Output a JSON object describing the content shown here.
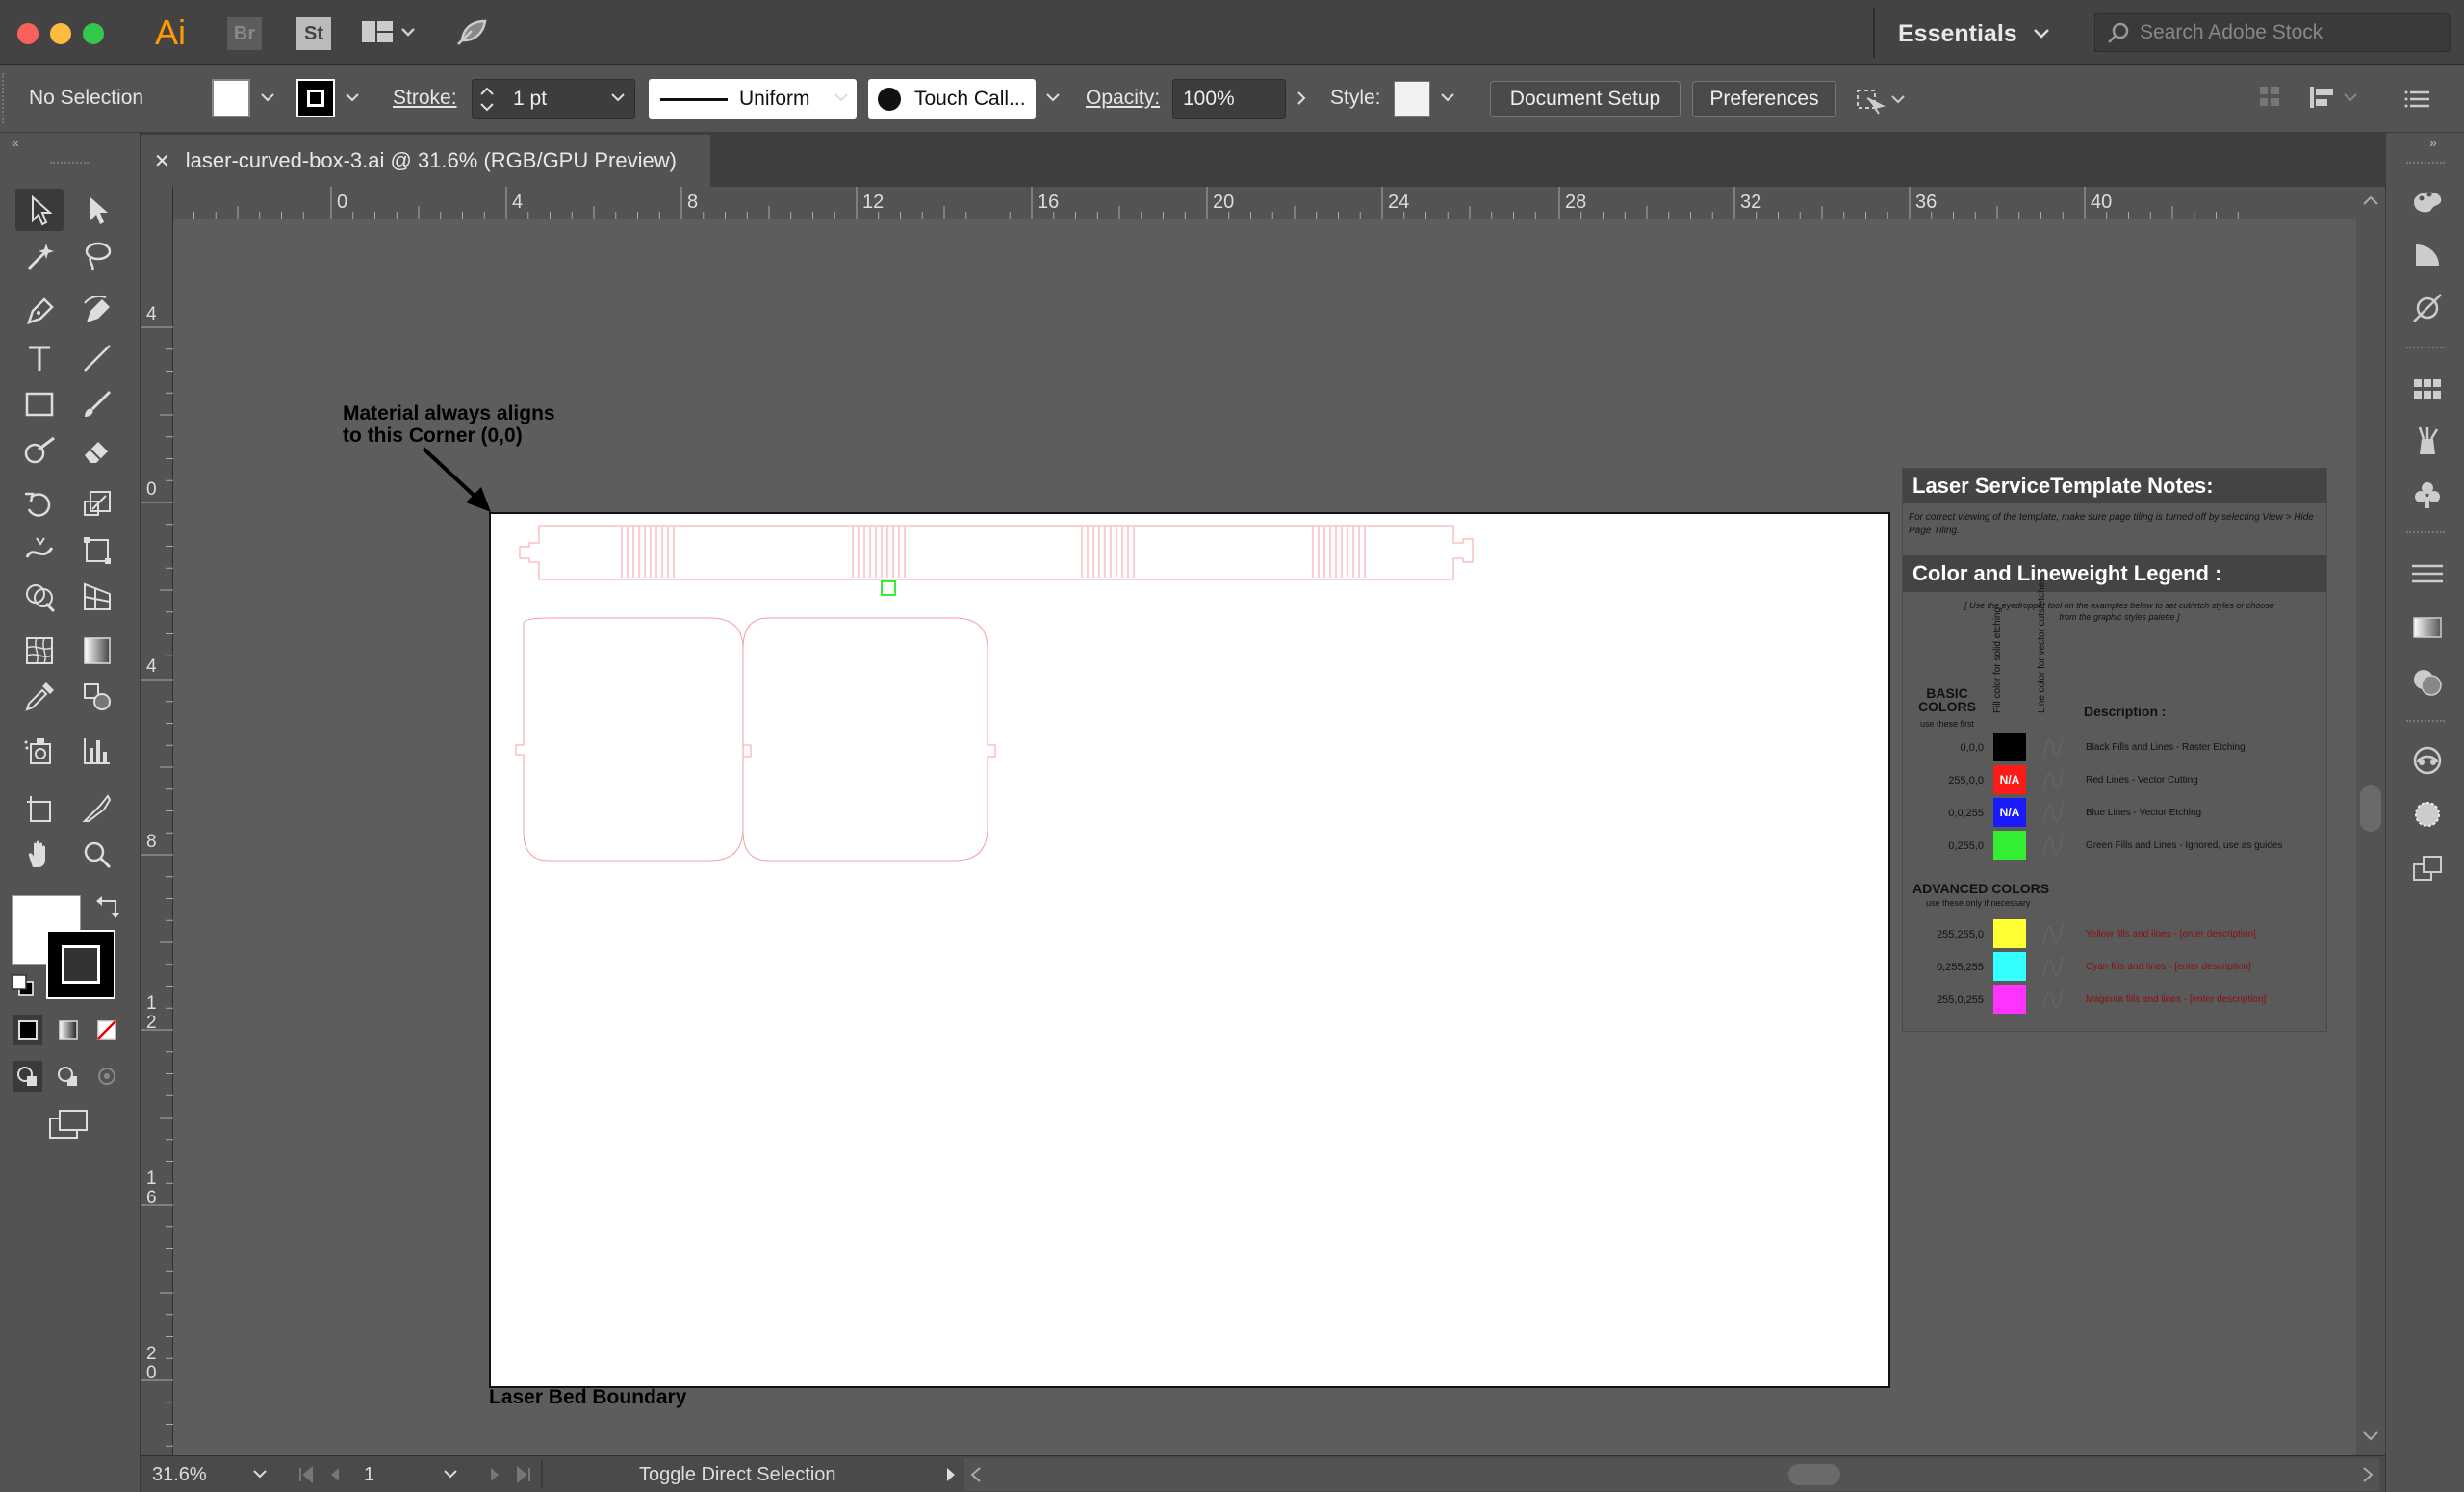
{
  "titlebar": {
    "app_icons": [
      "Ai",
      "Br",
      "St"
    ],
    "workspace": "Essentials",
    "search_placeholder": "Search Adobe Stock"
  },
  "control_bar": {
    "selection_status": "No Selection",
    "stroke_label": "Stroke:",
    "stroke_weight": "1 pt",
    "stroke_profile": "Uniform",
    "brush": "Touch Call...",
    "opacity_label": "Opacity:",
    "opacity_value": "100%",
    "style_label": "Style:",
    "document_setup_label": "Document Setup",
    "preferences_label": "Preferences"
  },
  "document_tab": {
    "close_glyph": "✕",
    "title": "laser-curved-box-3.ai @ 31.6% (RGB/GPU Preview)"
  },
  "rulers": {
    "horizontal": [
      "4",
      "0",
      "4",
      "8",
      "12",
      "16",
      "20",
      "24",
      "28",
      "32",
      "36",
      "40"
    ],
    "vertical": [
      "4",
      "0",
      "4",
      "8",
      "1\n2",
      "1\n6",
      "2\n0"
    ]
  },
  "canvas": {
    "annotation": "Material always aligns\nto this Corner (0,0)",
    "artboard_label": "Laser Bed Boundary"
  },
  "notes_panel": {
    "title": "Laser ServiceTemplate Notes:",
    "instructions": "For correct viewing of the template, make sure page tiling is turned off by selecting View > Hide Page Tiling.",
    "legend_title": "Color and Lineweight Legend :",
    "legend_hint": "[ Use the eyedropper tool on the examples below to set cut/etch styles or choose from the graphic styles palette ]",
    "basic_colors_label": "BASIC\nCOLORS",
    "basic_colors_sub": "use these first",
    "col_fill": "Fill color for solid etching",
    "col_line": "Line color for vector cuts/etches",
    "description_header": "Description :",
    "basic_rows": [
      {
        "value": "0,0,0",
        "color": "#000000",
        "na": "",
        "desc": "Black Fills and Lines - Raster Etching",
        "desc_color": "#111111"
      },
      {
        "value": "255,0,0",
        "color": "#ff1a1a",
        "na": "N/A",
        "desc": "Red Lines - Vector Cutting",
        "desc_color": "#111111"
      },
      {
        "value": "0,0,255",
        "color": "#1a1aff",
        "na": "N/A",
        "desc": "Blue Lines - Vector Etching",
        "desc_color": "#111111"
      },
      {
        "value": "0,255,0",
        "color": "#33ee33",
        "na": "",
        "desc": "Green Fills and Lines - Ignored, use as guides",
        "desc_color": "#111111"
      }
    ],
    "advanced_title": "ADVANCED COLORS",
    "advanced_sub": "use these only if necessary",
    "advanced_rows": [
      {
        "value": "255,255,0",
        "color": "#ffff33",
        "desc": "Yellow fills and lines - [enter description]",
        "desc_color": "#8a1010"
      },
      {
        "value": "0,255,255",
        "color": "#33ffff",
        "desc": "Cyan fills and lines - [enter description]",
        "desc_color": "#8a1010"
      },
      {
        "value": "255,0,255",
        "color": "#ff33ff",
        "desc": "Magenta fills and lines - [enter description]",
        "desc_color": "#8a1010"
      }
    ]
  },
  "status_bar": {
    "zoom": "31.6%",
    "artboard_number": "1",
    "current_tool": "Toggle Direct Selection"
  },
  "colors": {
    "accent_red_lines": "#f4a0a0",
    "guide_green": "#33ee33"
  }
}
